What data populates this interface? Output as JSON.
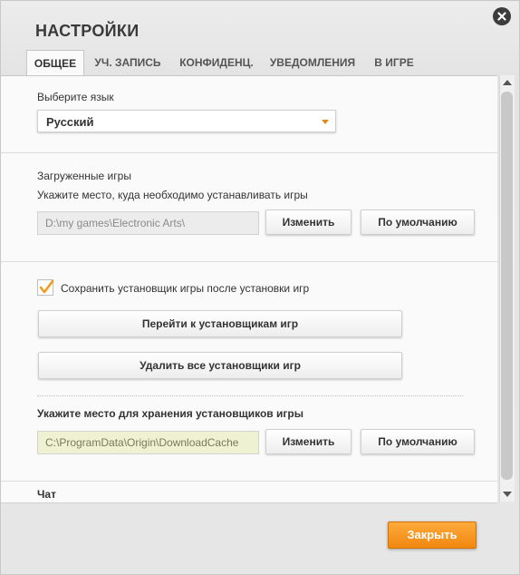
{
  "window": {
    "title": "НАСТРОЙКИ"
  },
  "tabs": [
    {
      "label": "ОБЩЕЕ",
      "active": true
    },
    {
      "label": "УЧ. ЗАПИСЬ",
      "active": false
    },
    {
      "label": "КОНФИДЕНЦ.",
      "active": false
    },
    {
      "label": "УВЕДОМЛЕНИЯ",
      "active": false
    },
    {
      "label": "В ИГРЕ",
      "active": false
    }
  ],
  "language": {
    "label": "Выберите язык",
    "selected": "Русский"
  },
  "downloaded_games": {
    "heading": "Загруженные игры",
    "description": "Укажите место, куда необходимо устанавливать игры",
    "path": "D:\\my games\\Electronic Arts\\",
    "change_label": "Изменить",
    "default_label": "По умолчанию"
  },
  "installers": {
    "keep_checkbox_label": "Сохранить установщик игры после установки игр",
    "keep_checked": true,
    "goto_button": "Перейти к установщикам игр",
    "delete_button": "Удалить все установщики игр",
    "location_heading": "Укажите место для хранения установщиков игры",
    "location_path": "C:\\ProgramData\\Origin\\DownloadCache",
    "change_label": "Изменить",
    "default_label": "По умолчанию"
  },
  "chat": {
    "heading": "Чат"
  },
  "footer": {
    "close_label": "Закрыть"
  },
  "colors": {
    "accent": "#f18810",
    "checkmark": "#f29a1f"
  },
  "icons": {
    "close": "close-icon",
    "dropdown": "chevron-down-icon",
    "check": "checkmark-icon"
  }
}
